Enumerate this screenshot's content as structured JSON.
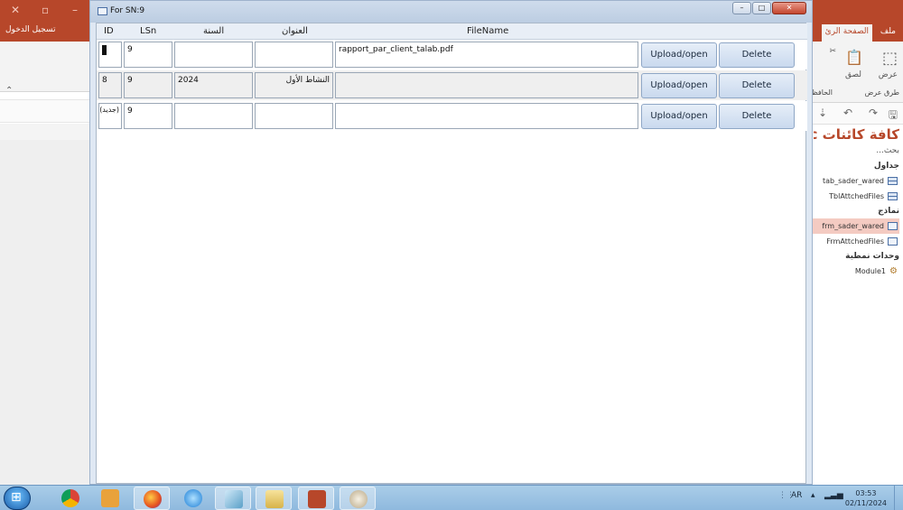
{
  "access": {
    "sign_in": "تسجيل الدخول",
    "tabs": {
      "file": "ملف",
      "home": "الصفحة الرئ"
    },
    "ribbon": {
      "view": "عرض",
      "paste": "لصق",
      "views_group": "طرق عرض",
      "clipboard_group": "الحافظ"
    },
    "nav": {
      "title": "كافة كائنات Acc",
      "search": "بحث...",
      "groups": [
        {
          "label": "جداول",
          "items": [
            "tab_sader_wared",
            "TblAttchedFiles"
          ]
        },
        {
          "label": "نماذج",
          "items": [
            "frm_sader_wared",
            "FrmAttchedFiles"
          ]
        },
        {
          "label": "وحدات نمطية",
          "items": [
            "Module1"
          ]
        }
      ],
      "selected_item": "frm_sader_wared"
    }
  },
  "popup": {
    "title": "For SN:9",
    "buttons": {
      "minimize": "–",
      "maximize": "□",
      "close": "✕"
    },
    "columns": {
      "id": "ID",
      "lsn": "LSn",
      "year": "السنة",
      "subject": "العنوان",
      "filename": "FileName"
    },
    "rows": [
      {
        "id": "9",
        "lsn": "9",
        "year": "",
        "subject": "",
        "filename": "rapport_par_client_talab.pdf",
        "upload": "Upload/open",
        "delete": "Delete"
      },
      {
        "id": "8",
        "lsn": "9",
        "year": "2024",
        "subject": "النشاط الأول",
        "filename": "",
        "upload": "Upload/open",
        "delete": "Delete"
      },
      {
        "id": "(جديد)",
        "lsn": "9",
        "year": "",
        "subject": "",
        "filename": "",
        "upload": "Upload/open",
        "delete": "Delete"
      }
    ]
  },
  "taskbar": {
    "apps": [
      "start",
      "chrome",
      "media-player",
      "firefox",
      "internet-explorer",
      "device",
      "file-explorer",
      "access",
      "paint"
    ],
    "language": "AR",
    "time": "03:53",
    "date": "02/11/2024"
  },
  "colors": {
    "access_brand": "#b7472a",
    "window_caption": "#bccde2",
    "button": "#c9d9ee",
    "taskbar": "#8fb9de"
  }
}
